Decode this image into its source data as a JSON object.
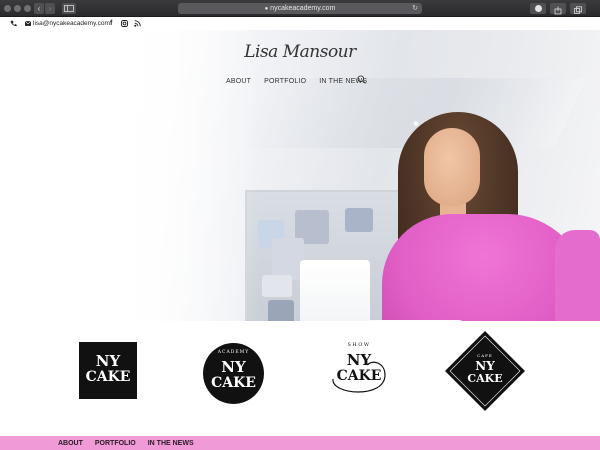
{
  "browser": {
    "url": "nycakeacademy.com",
    "back_label": "‹",
    "forward_label": "›",
    "reload_label": "↻"
  },
  "util_bar": {
    "email": "lisa@nycakeacademy.com",
    "phone_icon": "phone-icon",
    "email_icon": "envelope-icon",
    "social": [
      "facebook-icon",
      "instagram-icon",
      "rss-icon"
    ],
    "facebook_glyph": "f"
  },
  "header": {
    "logo_text": "Lisa Mansour",
    "nav": [
      "ABOUT",
      "PORTFOLIO",
      "IN THE NEWS"
    ],
    "search_icon": "search-icon"
  },
  "brands": [
    {
      "line1": "NY",
      "line2": "CAKE"
    },
    {
      "top": "ACADEMY",
      "line1": "NY",
      "line2": "CAKE"
    },
    {
      "top": "SHOW",
      "line1": "NY",
      "line2": "CAKE"
    },
    {
      "top": "CAFE",
      "line1": "NY",
      "line2": "CAKE"
    }
  ],
  "footer_nav": [
    "ABOUT",
    "PORTFOLIO",
    "IN THE NEWS"
  ],
  "colors": {
    "accent_pink": "#f09ad8",
    "jacket_pink": "#e05ec6",
    "logo_black": "#111111"
  }
}
